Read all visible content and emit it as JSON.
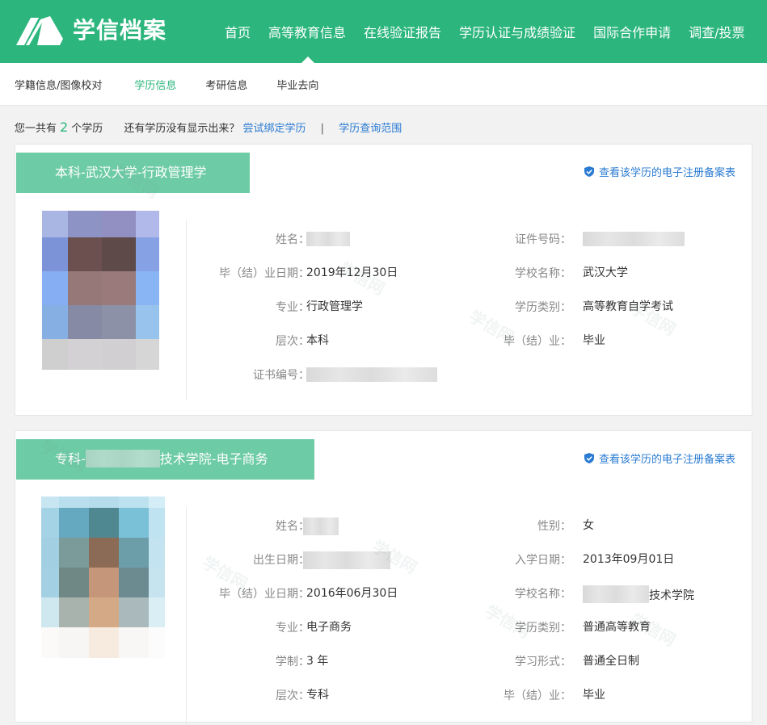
{
  "header": {
    "logo_text": "学信档案",
    "nav": [
      "首页",
      "高等教育信息",
      "在线验证报告",
      "学历认证与成绩验证",
      "国际合作申请",
      "调查/投票"
    ]
  },
  "subnav": [
    "学籍信息/图像校对",
    "学历信息",
    "考研信息",
    "毕业去向"
  ],
  "summary": {
    "prefix": "您一共有",
    "count": "2",
    "suffix": "个学历",
    "question": "还有学历没有显示出来？",
    "bind_link": "尝试绑定学历",
    "separator": "|",
    "range_link": "学历查询范围"
  },
  "register_link": "查看该学历的电子注册备案表",
  "watermark": "学信网",
  "card1": {
    "title": "本科-武汉大学-行政管理学",
    "labels": {
      "name": "姓名：",
      "id": "证件号码：",
      "grad_date": "毕（结）业日期：",
      "school": "学校名称：",
      "major": "专业：",
      "edu_type": "学历类别：",
      "level": "层次：",
      "status": "毕（结）业：",
      "cert": "证书编号："
    },
    "values": {
      "grad_date": "2019年12月30日",
      "school": "武汉大学",
      "major": "行政管理学",
      "edu_type": "高等教育自学考试",
      "level": "本科",
      "status": "毕业"
    }
  },
  "card2": {
    "title_prefix": "专科-",
    "title_suffix": "技术学院-电子商务",
    "labels": {
      "name": "姓名：",
      "gender": "性别：",
      "birth": "出生日期：",
      "enroll": "入学日期：",
      "grad_date": "毕（结）业日期：",
      "school": "学校名称：",
      "major": "专业：",
      "edu_type": "学历类别：",
      "duration": "学制：",
      "form": "学习形式：",
      "level": "层次：",
      "status": "毕（结）业："
    },
    "values": {
      "gender": "女",
      "enroll": "2013年09月01日",
      "grad_date": "2016年06月30日",
      "school_suffix": "技术学院",
      "major": "电子商务",
      "edu_type": "普通高等教育",
      "duration": "3 年",
      "form": "普通全日制",
      "level": "专科",
      "status": "毕业"
    }
  },
  "colors": {
    "brand": "#2cb67d",
    "tag": "#6dcba6",
    "link": "#2a7bd2"
  }
}
